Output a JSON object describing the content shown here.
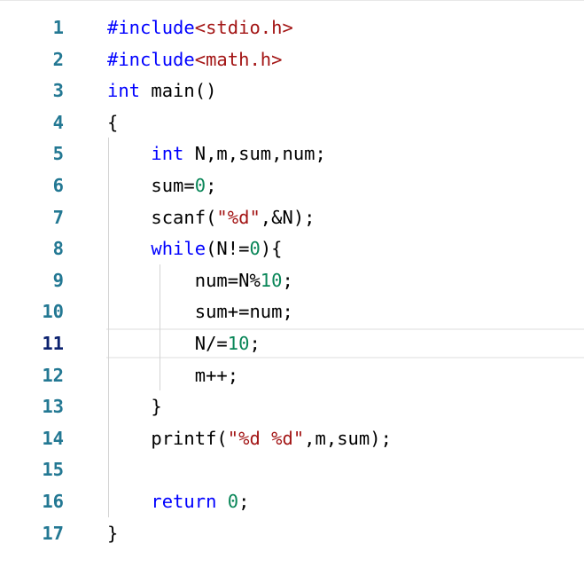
{
  "lines": [
    {
      "number": "1",
      "tokens": [
        {
          "t": "#include",
          "c": "kw"
        },
        {
          "t": "<",
          "c": "hdr"
        },
        {
          "t": "stdio.h",
          "c": "hdr"
        },
        {
          "t": ">",
          "c": "hdr"
        }
      ]
    },
    {
      "number": "2",
      "tokens": [
        {
          "t": "#include",
          "c": "kw"
        },
        {
          "t": "<",
          "c": "hdr"
        },
        {
          "t": "math.h",
          "c": "hdr"
        },
        {
          "t": ">",
          "c": "hdr"
        }
      ]
    },
    {
      "number": "3",
      "tokens": [
        {
          "t": "int",
          "c": "kw"
        },
        {
          "t": " main()",
          "c": ""
        }
      ]
    },
    {
      "number": "4",
      "tokens": [
        {
          "t": "{",
          "c": ""
        }
      ]
    },
    {
      "number": "5",
      "tokens": [
        {
          "t": "    ",
          "c": ""
        },
        {
          "t": "int",
          "c": "kw"
        },
        {
          "t": " N,m,sum,num;",
          "c": ""
        }
      ]
    },
    {
      "number": "6",
      "tokens": [
        {
          "t": "    sum=",
          "c": ""
        },
        {
          "t": "0",
          "c": "num"
        },
        {
          "t": ";",
          "c": ""
        }
      ]
    },
    {
      "number": "7",
      "tokens": [
        {
          "t": "    scanf(",
          "c": ""
        },
        {
          "t": "\"%d\"",
          "c": "str"
        },
        {
          "t": ",&N);",
          "c": ""
        }
      ]
    },
    {
      "number": "8",
      "tokens": [
        {
          "t": "    ",
          "c": ""
        },
        {
          "t": "while",
          "c": "kw"
        },
        {
          "t": "(N!=",
          "c": ""
        },
        {
          "t": "0",
          "c": "num"
        },
        {
          "t": "){",
          "c": ""
        }
      ]
    },
    {
      "number": "9",
      "tokens": [
        {
          "t": "        num=N%",
          "c": ""
        },
        {
          "t": "10",
          "c": "num"
        },
        {
          "t": ";",
          "c": ""
        }
      ]
    },
    {
      "number": "10",
      "tokens": [
        {
          "t": "        sum+=num;",
          "c": ""
        }
      ]
    },
    {
      "number": "11",
      "tokens": [
        {
          "t": "        N/=",
          "c": ""
        },
        {
          "t": "10",
          "c": "num"
        },
        {
          "t": ";",
          "c": ""
        }
      ]
    },
    {
      "number": "12",
      "tokens": [
        {
          "t": "        m++;",
          "c": ""
        }
      ]
    },
    {
      "number": "13",
      "tokens": [
        {
          "t": "    }",
          "c": ""
        }
      ]
    },
    {
      "number": "14",
      "tokens": [
        {
          "t": "    printf(",
          "c": ""
        },
        {
          "t": "\"%d %d\"",
          "c": "str"
        },
        {
          "t": ",m,sum);",
          "c": ""
        }
      ]
    },
    {
      "number": "15",
      "tokens": []
    },
    {
      "number": "16",
      "tokens": [
        {
          "t": "    ",
          "c": ""
        },
        {
          "t": "return",
          "c": "kw"
        },
        {
          "t": " ",
          "c": ""
        },
        {
          "t": "0",
          "c": "num"
        },
        {
          "t": ";",
          "c": ""
        }
      ]
    },
    {
      "number": "17",
      "tokens": [
        {
          "t": "}",
          "c": ""
        }
      ]
    }
  ],
  "active_line": 11,
  "colors": {
    "keyword": "#0000ff",
    "string": "#a31515",
    "number": "#098658",
    "line_number": "#237893",
    "active_line_number": "#0b216f"
  }
}
